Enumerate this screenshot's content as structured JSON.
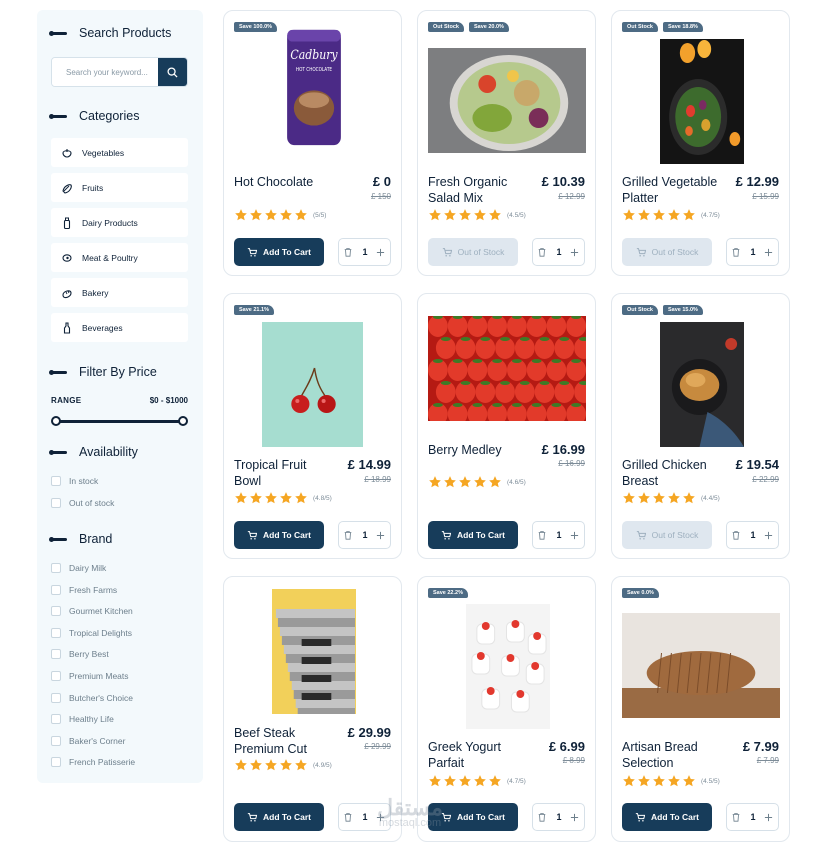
{
  "sidebar": {
    "search": {
      "title": "Search Products",
      "placeholder": "Search your keyword..."
    },
    "categories": {
      "title": "Categories",
      "items": [
        {
          "label": "Vegetables",
          "icon": "vegetable-icon"
        },
        {
          "label": "Fruits",
          "icon": "fruit-icon"
        },
        {
          "label": "Dairy Products",
          "icon": "milk-bottle-icon"
        },
        {
          "label": "Meat & Poultry",
          "icon": "meat-icon"
        },
        {
          "label": "Bakery",
          "icon": "bread-icon"
        },
        {
          "label": "Beverages",
          "icon": "beverage-bottle-icon"
        }
      ]
    },
    "price": {
      "title": "Filter By Price",
      "range_label": "RANGE",
      "range_value": "$0 - $1000"
    },
    "availability": {
      "title": "Availability",
      "options": [
        "In stock",
        "Out of stock"
      ]
    },
    "brand": {
      "title": "Brand",
      "options": [
        "Dairy Milk",
        "Fresh Farms",
        "Gourmet Kitchen",
        "Tropical Delights",
        "Berry Best",
        "Premium Meats",
        "Butcher's Choice",
        "Healthy Life",
        "Baker's Corner",
        "French Patisserie"
      ]
    }
  },
  "products": [
    {
      "name": "Hot Chocolate",
      "price": "£ 0",
      "old_price": "£ 150",
      "rating_text": "(5/5)",
      "rating": 5,
      "badges": [
        "Save 100.0%"
      ],
      "cart_label": "Add To Cart",
      "in_stock": true,
      "qty": "1",
      "image": "hot-chocolate-can"
    },
    {
      "name": "Fresh Organic Salad Mix",
      "price": "£ 10.39",
      "old_price": "£ 12.99",
      "rating_text": "(4.5/5)",
      "rating": 4.5,
      "badges": [
        "Out Stock",
        "Save 20.0%"
      ],
      "cart_label": "Out of Stock",
      "in_stock": false,
      "qty": "1",
      "image": "salad-bowl"
    },
    {
      "name": "Grilled Vegetable Platter",
      "price": "£ 12.99",
      "old_price": "£ 15.99",
      "rating_text": "(4.7/5)",
      "rating": 4.7,
      "badges": [
        "Out Stock",
        "Save 18.8%"
      ],
      "cart_label": "Out of Stock",
      "in_stock": false,
      "qty": "1",
      "image": "vegetable-platter"
    },
    {
      "name": "Tropical Fruit Bowl",
      "price": "£ 14.99",
      "old_price": "£ 18.99",
      "rating_text": "(4.8/5)",
      "rating": 4.8,
      "badges": [
        "Save 21.1%"
      ],
      "cart_label": "Add To Cart",
      "in_stock": true,
      "qty": "1",
      "image": "cherries"
    },
    {
      "name": "Berry Medley",
      "price": "£ 16.99",
      "old_price": "£ 16.99",
      "rating_text": "(4.6/5)",
      "rating": 4.6,
      "badges": [],
      "cart_label": "Add To Cart",
      "in_stock": true,
      "qty": "1",
      "image": "strawberries"
    },
    {
      "name": "Grilled Chicken Breast",
      "price": "£ 19.54",
      "old_price": "£ 22.99",
      "rating_text": "(4.4/5)",
      "rating": 4.4,
      "badges": [
        "Out Stock",
        "Save 15.0%"
      ],
      "cart_label": "Out of Stock",
      "in_stock": false,
      "qty": "1",
      "image": "roast-chicken"
    },
    {
      "name": "Beef Steak Premium Cut",
      "price": "£ 29.99",
      "old_price": "£ 29.99",
      "rating_text": "(4.9/5)",
      "rating": 4.9,
      "badges": [],
      "cart_label": "Add To Cart",
      "in_stock": true,
      "qty": "1",
      "image": "stairs"
    },
    {
      "name": "Greek Yogurt Parfait",
      "price": "£ 6.99",
      "old_price": "£ 8.99",
      "rating_text": "(4.7/5)",
      "rating": 4.7,
      "badges": [
        "Save 22.2%"
      ],
      "cart_label": "Add To Cart",
      "in_stock": true,
      "qty": "1",
      "image": "yogurt-cups"
    },
    {
      "name": "Artisan Bread Selection",
      "price": "£ 7.99",
      "old_price": "£ 7.99",
      "rating_text": "(4.5/5)",
      "rating": 4.5,
      "badges": [
        "Save 0.0%"
      ],
      "cart_label": "Add To Cart",
      "in_stock": true,
      "qty": "1",
      "image": "bread-loaf"
    }
  ],
  "watermark": {
    "text": "مستقل",
    "sub": "mostaql.com"
  },
  "colors": {
    "primary": "#173c5a",
    "badge": "#4d6b84",
    "star": "#f5a623",
    "sidebar_bg": "#f3f9fc",
    "disabled_btn": "#dfe7ef"
  }
}
